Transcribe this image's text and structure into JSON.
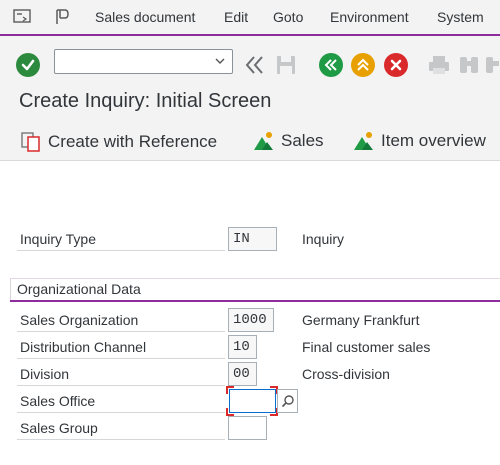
{
  "menubar": {
    "items": [
      "Sales document",
      "Edit",
      "Goto",
      "Environment",
      "System"
    ]
  },
  "toolbar": {
    "command_value": "",
    "icons": [
      "enter-icon",
      "command-field-dropdown-icon",
      "back-double-icon",
      "save-icon",
      "back-icon",
      "exit-icon",
      "cancel-icon",
      "print-icon",
      "find-icon",
      "find-next-icon"
    ]
  },
  "title": {
    "text": "Create Inquiry: Initial Screen"
  },
  "app_toolbar": {
    "create_with_reference": "Create with Reference",
    "sales": "Sales",
    "item_overview": "Item overview"
  },
  "form": {
    "inquiry_type": {
      "label": "Inquiry Type",
      "value": "IN",
      "description": "Inquiry"
    },
    "org_group_title": "Organizational Data",
    "sales_org": {
      "label": "Sales Organization",
      "value": "1000",
      "description": "Germany Frankfurt"
    },
    "distribution_channel": {
      "label": "Distribution Channel",
      "value": "10",
      "description": "Final customer sales"
    },
    "division": {
      "label": "Division",
      "value": "00",
      "description": "Cross-division"
    },
    "sales_office": {
      "label": "Sales Office",
      "value": ""
    },
    "sales_group": {
      "label": "Sales Group",
      "value": ""
    }
  },
  "colors": {
    "accent": "#8e2b9e",
    "enter_green": "#2b8a3e",
    "back_green": "#1f9a45",
    "exit_orange": "#e8a000",
    "cancel_red": "#d9292b"
  }
}
